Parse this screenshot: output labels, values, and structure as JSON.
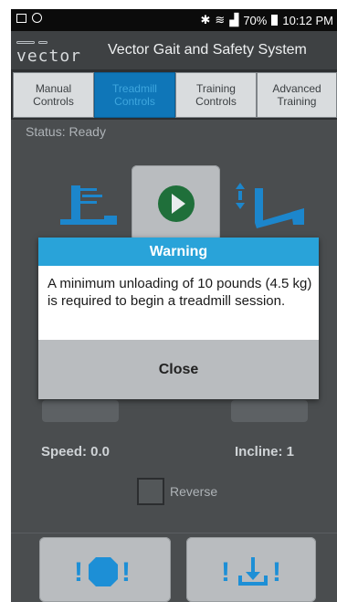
{
  "statusbar": {
    "battery": "70%",
    "time": "10:12 PM",
    "icons": [
      "image-icon",
      "ring-icon",
      "bluetooth-icon",
      "wifi-icon",
      "signal-icon",
      "battery-icon"
    ]
  },
  "app": {
    "logo": "vector",
    "title": "Vector Gait and Safety System"
  },
  "tabs": [
    {
      "label": "Manual\nControls",
      "active": false
    },
    {
      "label": "Treadmill\nControls",
      "active": true
    },
    {
      "label": "Training\nControls",
      "active": false
    },
    {
      "label": "Advanced\nTraining",
      "active": false
    }
  ],
  "status": {
    "text": "Status:  Ready"
  },
  "readouts": {
    "speed": "Speed: 0.0",
    "incline": "Incline: 1"
  },
  "reverse": {
    "label": "Reverse",
    "checked": false
  },
  "bottom_buttons": [
    {
      "icon": "emergency-stop-icon",
      "text": "!●!"
    },
    {
      "icon": "unload-icon",
      "text": "!⤓!"
    }
  ],
  "dialog": {
    "title": "Warning",
    "message": "A minimum unloading of 10 pounds (4.5 kg) is required to begin a treadmill session.",
    "close_label": "Close"
  },
  "colors": {
    "accent": "#29a3d9",
    "active_tab": "#0f76b8",
    "play": "#1f6f3a",
    "background": "#4a4d4f"
  }
}
